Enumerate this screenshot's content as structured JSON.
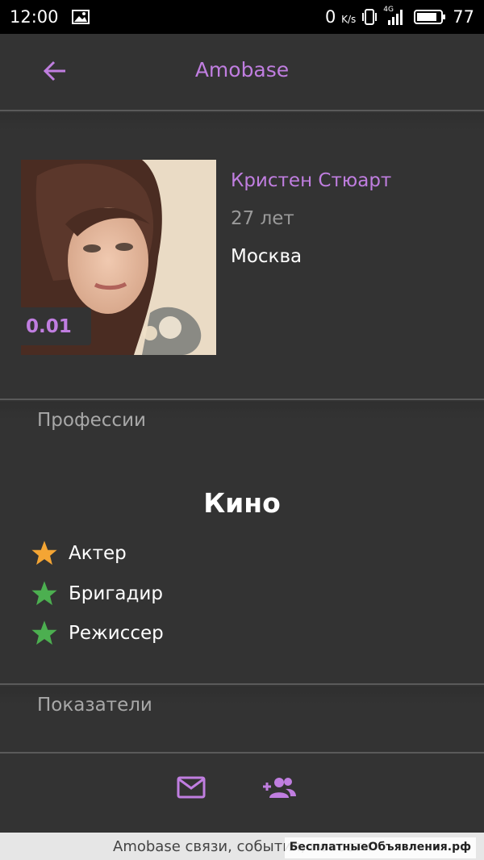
{
  "status": {
    "time": "12:00",
    "speed": "0",
    "speed_unit": "K/s",
    "network": "4G",
    "battery": "77"
  },
  "toolbar": {
    "title": "Amobase"
  },
  "profile": {
    "name": "Кристен Стюарт",
    "age": "27 лет",
    "city": "Москва",
    "rating": "0.01"
  },
  "sections": {
    "professions_header": "Профессии",
    "indicators_header": "Показатели"
  },
  "professions": {
    "category": "Кино",
    "items": [
      {
        "label": "Актер",
        "star_color": "#f4a534"
      },
      {
        "label": "Бригадир",
        "star_color": "#4caf50"
      },
      {
        "label": "Режиссер",
        "star_color": "#4caf50"
      }
    ]
  },
  "footer": {
    "text": "Amobase связи, события, новости",
    "watermark": "БесплатныеОбъявления.рф"
  },
  "colors": {
    "accent": "#c07ee0",
    "background": "#333333"
  }
}
